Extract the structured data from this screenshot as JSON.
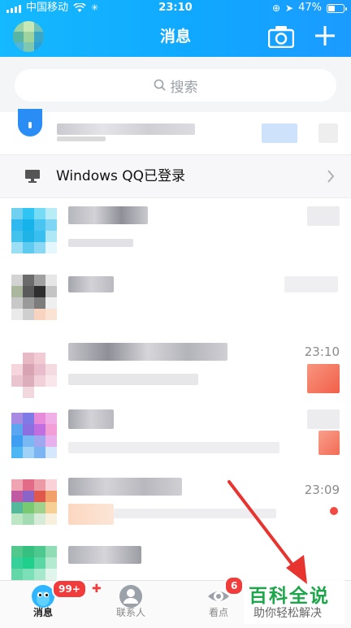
{
  "status_bar": {
    "carrier": "中国移动",
    "time": "23:10",
    "battery_percent": "47%",
    "battery_level": 0.47
  },
  "nav": {
    "title": "消息"
  },
  "search": {
    "placeholder": "搜索"
  },
  "device_login": {
    "label": "Windows QQ已登录"
  },
  "conversations": [
    {
      "time": ""
    },
    {
      "time": ""
    },
    {
      "time": "23:10"
    },
    {
      "time": ""
    },
    {
      "time": "23:09"
    },
    {
      "time": ""
    }
  ],
  "tabs": [
    {
      "label": "消息",
      "badge": "99+",
      "active": true
    },
    {
      "label": "联系人",
      "badge": ""
    },
    {
      "label": "看点",
      "badge": "6"
    }
  ],
  "watermark": {
    "title": "百科全说",
    "subtitle": "助你轻松解决"
  },
  "colors": {
    "header": "#10a8ff",
    "badge": "#f23b3b",
    "watermark": "#1ea64a",
    "arrow": "#e8342f"
  }
}
